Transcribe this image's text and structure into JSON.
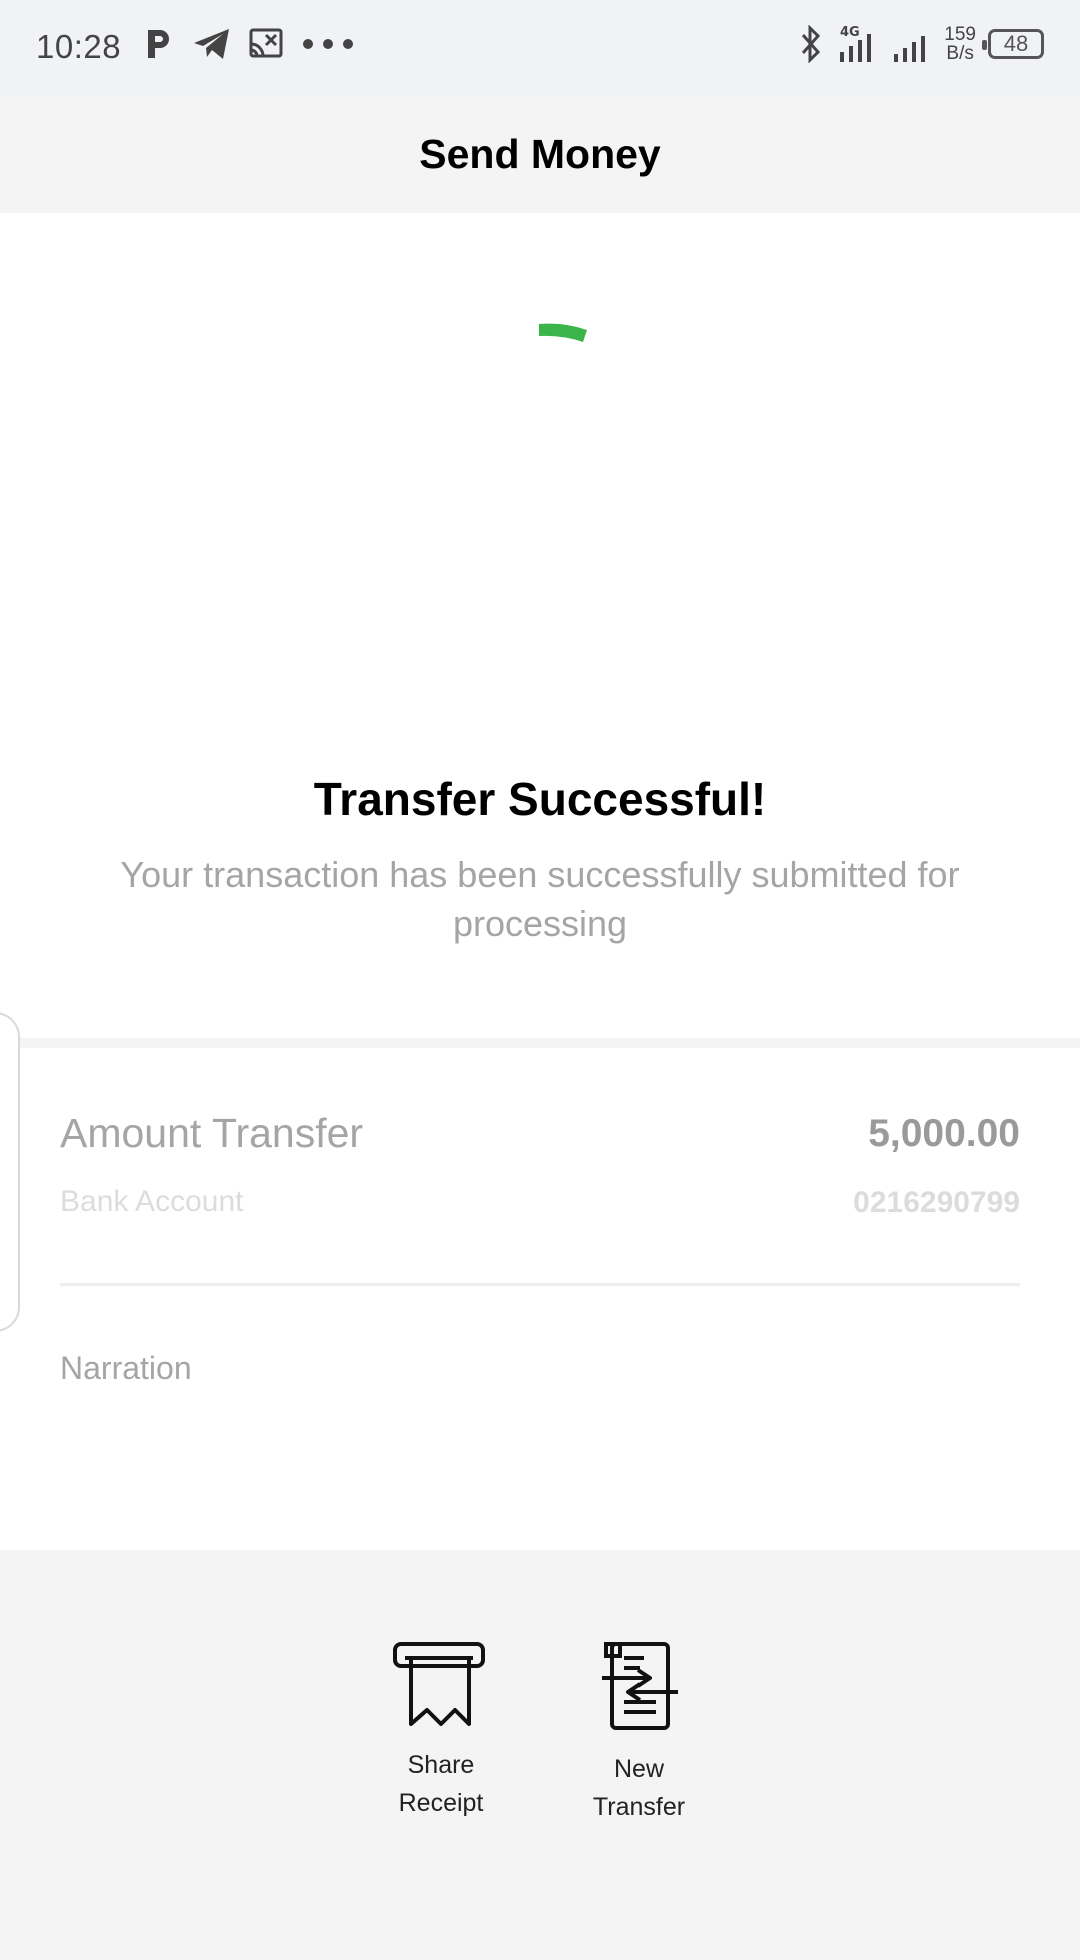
{
  "status_bar": {
    "time": "10:28",
    "net_speed_value": "159",
    "net_speed_unit": "B/s",
    "battery": "48",
    "network": "4G"
  },
  "header": {
    "title": "Send Money"
  },
  "result": {
    "title": "Transfer Successful!",
    "subtitle": "Your transaction has been successfully submitted for processing",
    "spinner_color": "#3bb54a"
  },
  "details": {
    "amount_label": "Amount Transfer",
    "amount_value": "5,000.00",
    "bank_label": "Bank Account",
    "bank_value": "0216290799",
    "narration_label": "Narration"
  },
  "actions": {
    "share_receipt": "Share\nReceipt",
    "new_transfer": "New\nTransfer"
  }
}
